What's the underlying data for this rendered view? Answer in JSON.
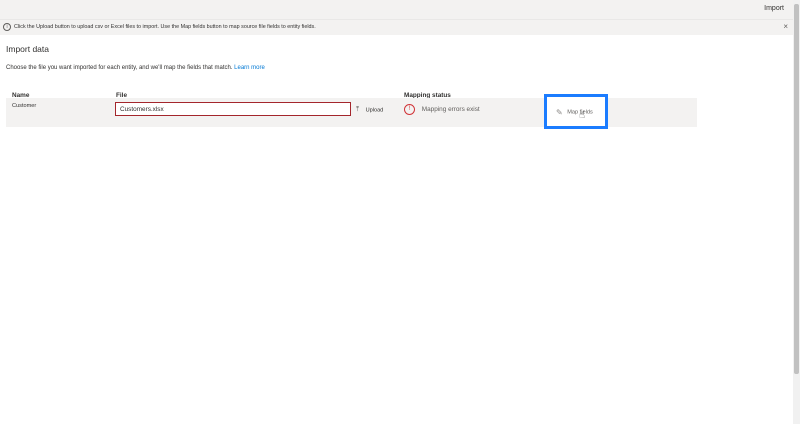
{
  "command_bar": {
    "import_label": "Import"
  },
  "info_bar": {
    "icon": "info-icon",
    "message": "Click the Upload button to upload csv or Excel files to import. Use the Map fields button to map source file fields to entity fields.",
    "close_label": "×"
  },
  "page": {
    "title": "Import data",
    "instructions": "Choose the file you want imported for each entity, and we'll map the fields that match.",
    "learn_more": "Learn more"
  },
  "table": {
    "headers": {
      "name": "Name",
      "file": "File",
      "status": "Mapping status"
    },
    "rows": [
      {
        "name": "Customer",
        "file": "Customers.xlsx",
        "upload_label": "Upload",
        "status": "Mapping errors exist",
        "status_icon": "error-icon",
        "action_label": "Map fields"
      }
    ]
  },
  "colors": {
    "accent": "#0078d4",
    "error": "#d13438",
    "highlight": "#1b7cff"
  }
}
